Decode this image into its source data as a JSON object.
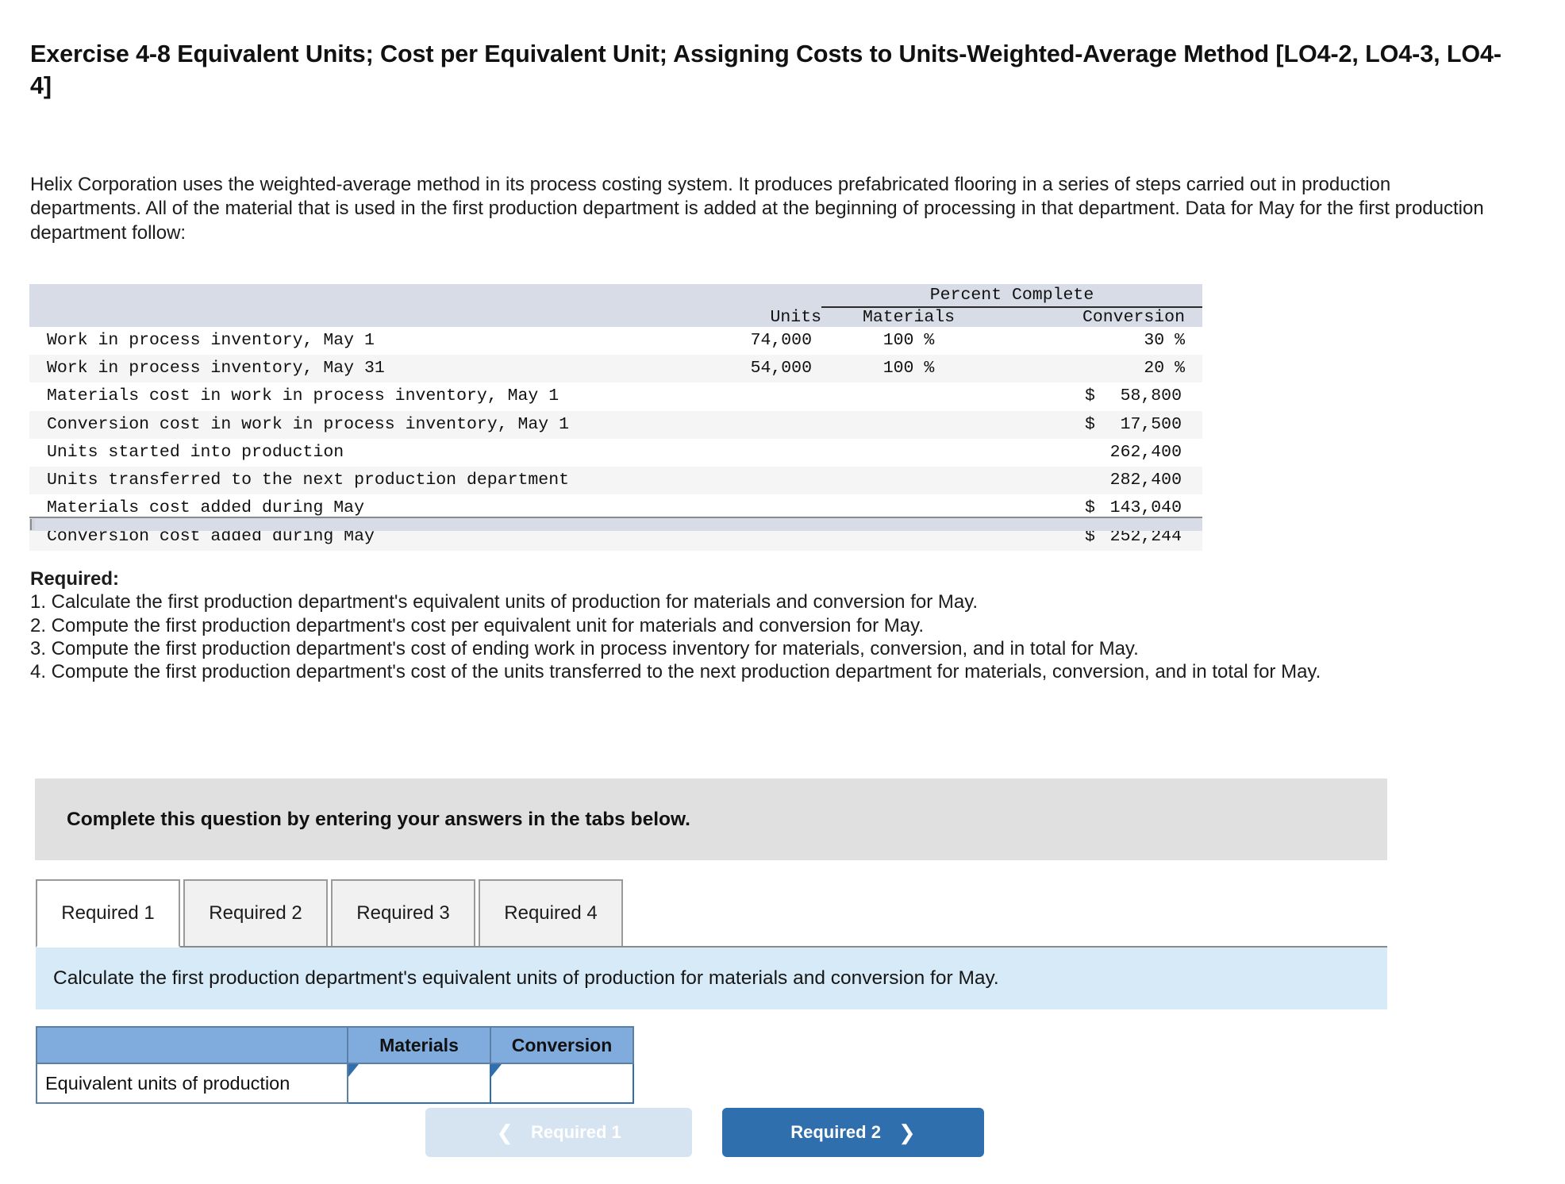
{
  "exercise": {
    "title": "Exercise 4-8 Equivalent Units; Cost per Equivalent Unit; Assigning Costs to Units-Weighted-Average Method [LO4-2, LO4-3, LO4-4]",
    "intro": "Helix Corporation uses the weighted-average method in its process costing system. It produces prefabricated flooring in a series of steps carried out in production departments. All of the material that is used in the first production department is added at the beginning of processing in that department. Data for May for the first production department follow:"
  },
  "data_table": {
    "group_header": "Percent Complete",
    "columns": {
      "units": "Units",
      "materials": "Materials",
      "conversion": "Conversion"
    },
    "rows": [
      {
        "label": "Work in process inventory, May 1",
        "units": "74,000",
        "materials": "100 %",
        "conversion": "30 %",
        "money": ""
      },
      {
        "label": "Work in process inventory, May 31",
        "units": "54,000",
        "materials": "100 %",
        "conversion": "20 %",
        "money": ""
      },
      {
        "label": "Materials cost in work in process inventory, May 1",
        "units": "",
        "materials": "",
        "conversion": "",
        "money_sym": "$",
        "money_num": "58,800"
      },
      {
        "label": "Conversion cost in work in process inventory, May 1",
        "units": "",
        "materials": "",
        "conversion": "",
        "money_sym": "$",
        "money_num": "17,500"
      },
      {
        "label": "Units started into production",
        "units": "",
        "materials": "",
        "conversion": "",
        "money_sym": "",
        "money_num": "262,400"
      },
      {
        "label": "Units transferred to the next production department",
        "units": "",
        "materials": "",
        "conversion": "",
        "money_sym": "",
        "money_num": "282,400"
      },
      {
        "label": "Materials cost added during May",
        "units": "",
        "materials": "",
        "conversion": "",
        "money_sym": "$",
        "money_num": "143,040"
      },
      {
        "label": "Conversion cost added during May",
        "units": "",
        "materials": "",
        "conversion": "",
        "money_sym": "$",
        "money_num": "252,244"
      }
    ]
  },
  "required": {
    "heading": "Required:",
    "items": [
      "1. Calculate the first production department's equivalent units of production for materials and conversion for May.",
      "2. Compute the first production department's cost per equivalent unit for materials and conversion for May.",
      "3. Compute the first production department's cost of ending work in process inventory for materials, conversion, and in total for May.",
      "4. Compute the first production department's cost of the units transferred to the next production department for materials, conversion, and in total for May."
    ]
  },
  "instruction_banner": "Complete this question by entering your answers in the tabs below.",
  "tabs": [
    {
      "label": "Required 1",
      "active": true
    },
    {
      "label": "Required 2",
      "active": false
    },
    {
      "label": "Required 3",
      "active": false
    },
    {
      "label": "Required 4",
      "active": false
    }
  ],
  "question_banner": "Calculate the first production department's equivalent units of production for materials and conversion for May.",
  "answer_table": {
    "blank_header": "",
    "headers": [
      "Materials",
      "Conversion"
    ],
    "row_label": "Equivalent units of production",
    "values": [
      "",
      ""
    ]
  },
  "nav": {
    "prev_label": "Required 1",
    "next_label": "Required 2",
    "prev_icon": "chevron-left",
    "next_icon": "chevron-right"
  },
  "colors": {
    "header_bg": "#d7dce6",
    "gray_banner": "#e0e0e0",
    "blue_banner": "#d6eaf8",
    "answer_header": "#7fabdd",
    "primary_button": "#2f6fad",
    "disabled_button": "#d6e4f2"
  }
}
